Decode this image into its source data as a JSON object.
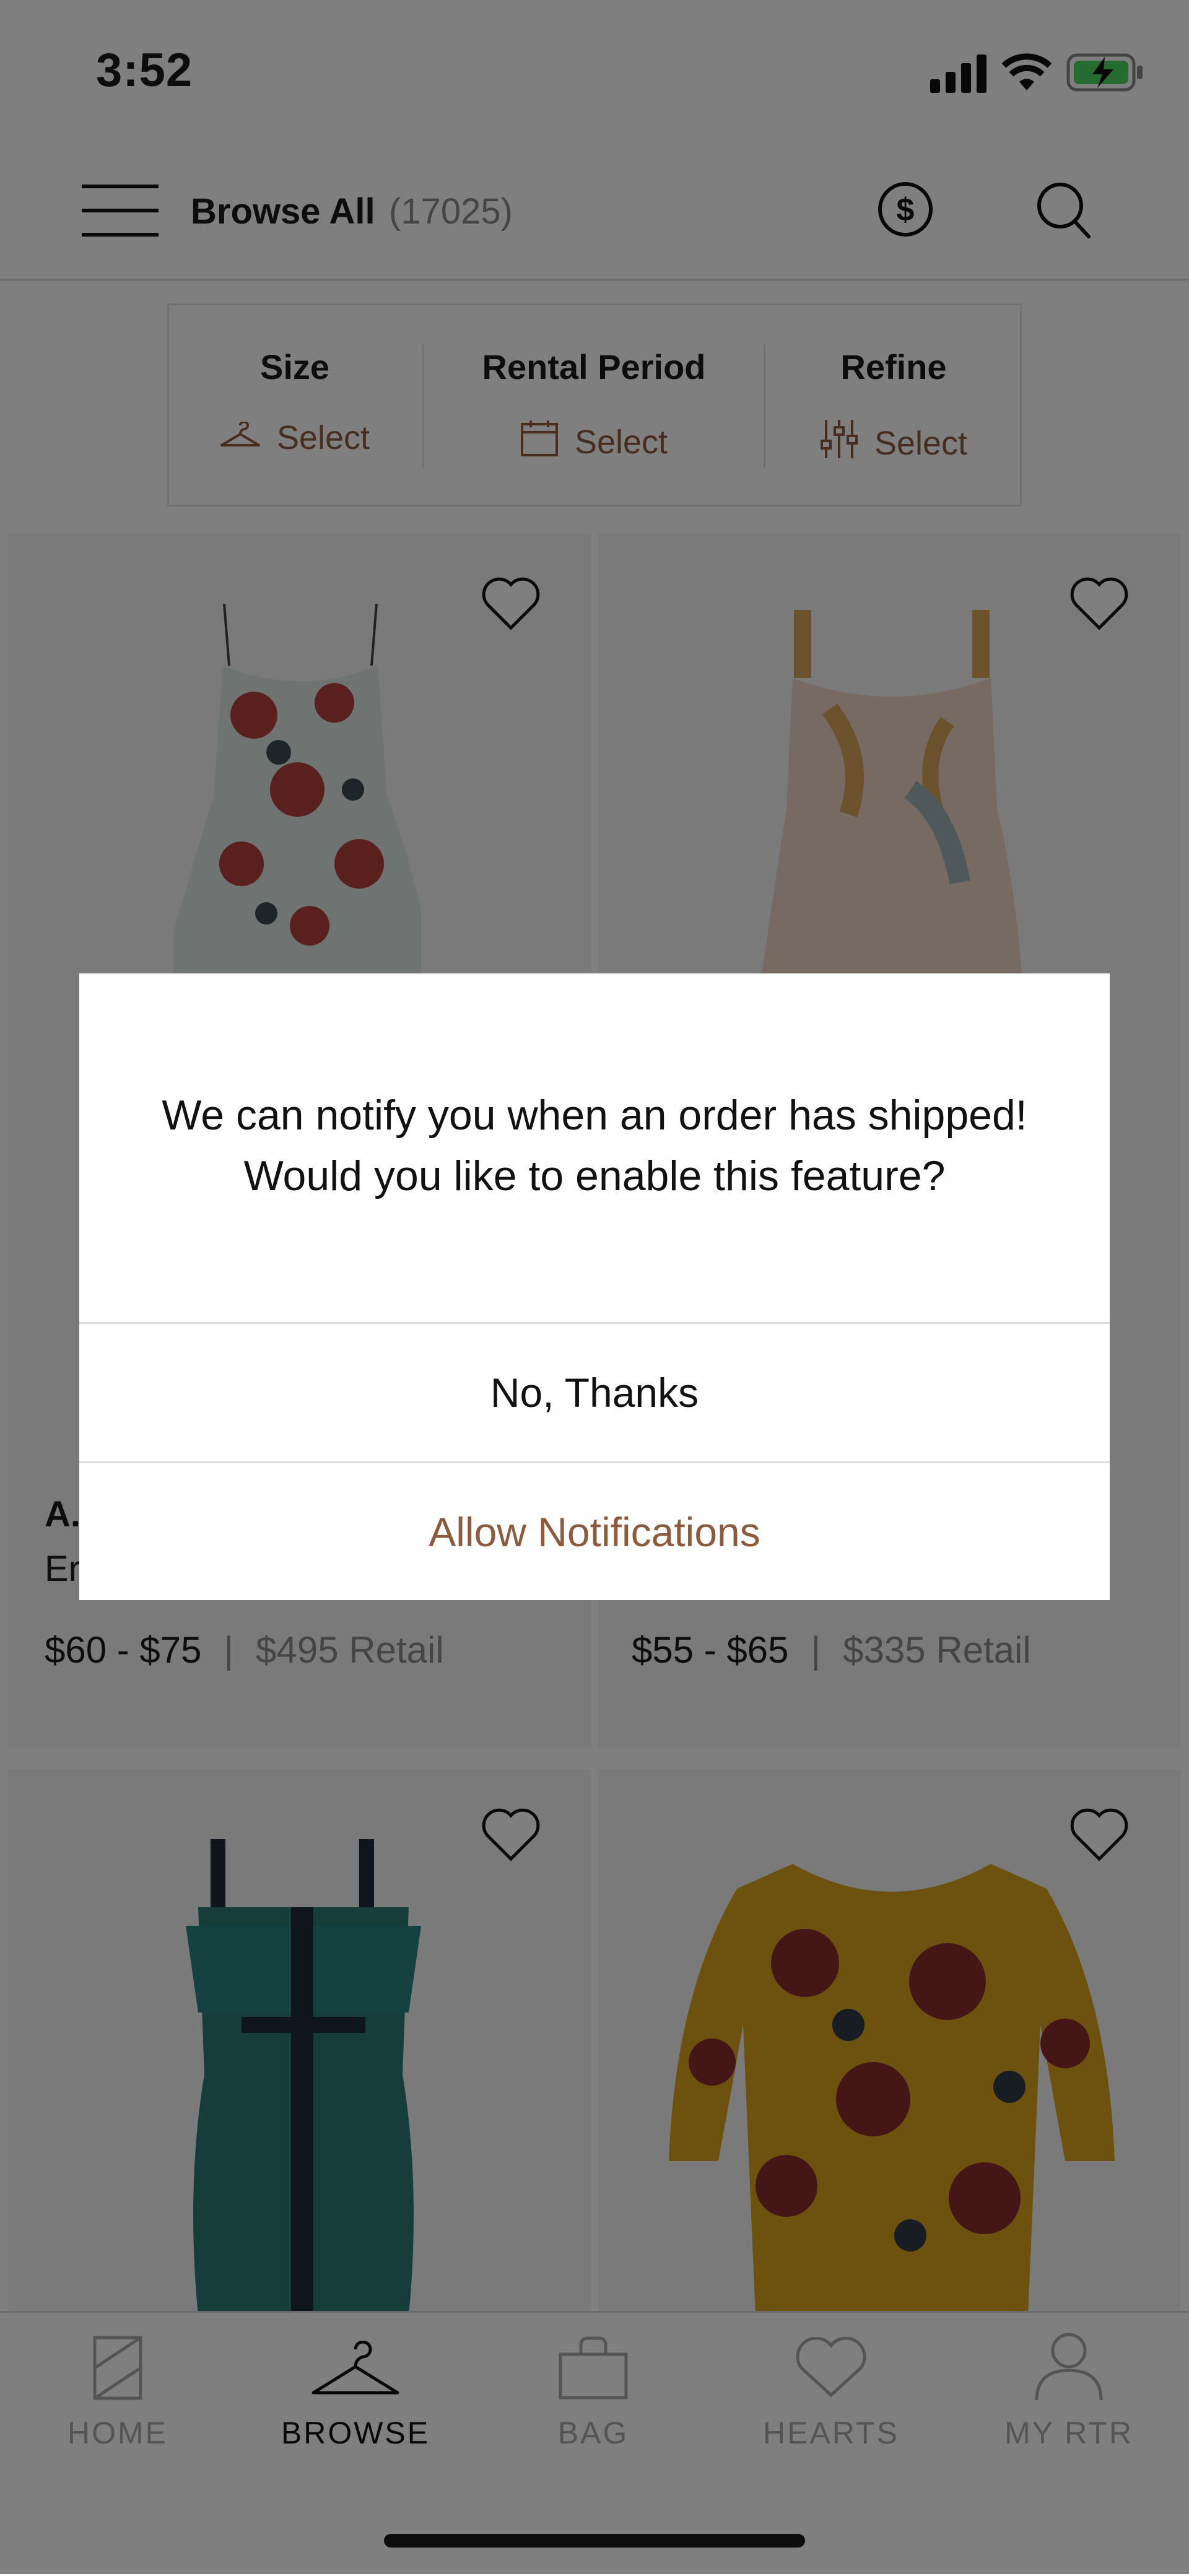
{
  "status_bar": {
    "time": "3:52"
  },
  "header": {
    "title": "Browse All",
    "count": "(17025)"
  },
  "filters": [
    {
      "title": "Size",
      "value": "Select",
      "icon": "hanger-icon"
    },
    {
      "title": "Rental Period",
      "value": "Select",
      "icon": "calendar-icon"
    },
    {
      "title": "Refine",
      "value": "Select",
      "icon": "sliders-icon"
    }
  ],
  "products": [
    {
      "brand_partial": "A.",
      "name_partial": "Er",
      "price": "$60 - $75",
      "retail": "$495 Retail"
    },
    {
      "price": "$55 - $65",
      "retail": "$335 Retail"
    }
  ],
  "tabs": [
    {
      "label": "HOME",
      "icon": "home-icon"
    },
    {
      "label": "BROWSE",
      "icon": "hanger-icon",
      "active": true
    },
    {
      "label": "BAG",
      "icon": "bag-icon"
    },
    {
      "label": "HEARTS",
      "icon": "heart-icon"
    },
    {
      "label": "MY RTR",
      "icon": "person-icon"
    }
  ],
  "dialog": {
    "line1": "We can notify you when an order has shipped!",
    "line2": "Would you like to enable this feature?",
    "decline_label": "No, Thanks",
    "allow_label": "Allow Notifications"
  },
  "colors": {
    "accent": "#8c5a3c",
    "overlay": "rgba(0,0,0,0.5)"
  }
}
